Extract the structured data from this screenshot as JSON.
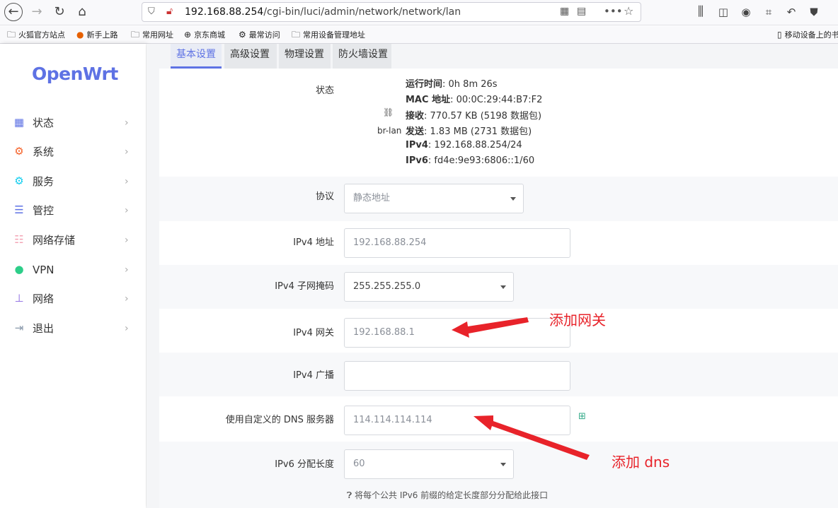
{
  "browser": {
    "url_host": "192.168.88.254",
    "url_path": "/cgi-bin/luci/admin/network/network/lan"
  },
  "bookmarks": [
    {
      "label": "火狐官方站点",
      "icon": "folder-icon"
    },
    {
      "label": "新手上路",
      "icon": "firefox-icon"
    },
    {
      "label": "常用网址",
      "icon": "folder-icon"
    },
    {
      "label": "京东商城",
      "icon": "globe-icon"
    },
    {
      "label": "最常访问",
      "icon": "gear-icon"
    },
    {
      "label": "常用设备管理地址",
      "icon": "folder-icon"
    }
  ],
  "mobile_bookmarks": "移动设备上的书",
  "logo": "OpenWrt",
  "nav": [
    {
      "label": "状态",
      "icon": "dashboard-icon",
      "color": "#5e72e4"
    },
    {
      "label": "系统",
      "icon": "gear-icon",
      "color": "#f5632a"
    },
    {
      "label": "服务",
      "icon": "cogs-icon",
      "color": "#11cdef"
    },
    {
      "label": "管控",
      "icon": "sliders-icon",
      "color": "#5e72e4"
    },
    {
      "label": "网络存储",
      "icon": "database-icon",
      "color": "#f3a4b5"
    },
    {
      "label": "VPN",
      "icon": "globe-icon",
      "color": "#2dce89"
    },
    {
      "label": "网络",
      "icon": "sitemap-icon",
      "color": "#8965e0"
    },
    {
      "label": "退出",
      "icon": "logout-icon",
      "color": "#8898aa"
    }
  ],
  "tabs": [
    "基本设置",
    "高级设置",
    "物理设置",
    "防火墙设置"
  ],
  "status": {
    "label": "状态",
    "iface": "br-lan",
    "uptime_key": "运行时间",
    "uptime_val": ": 0h 8m 26s",
    "mac_key": "MAC 地址",
    "mac_val": ": 00:0C:29:44:B7:F2",
    "rx_key": "接收",
    "rx_val": ": 770.57 KB (5198 数据包)",
    "tx_key": "发送",
    "tx_val": ": 1.83 MB (2731 数据包)",
    "ipv4_key": "IPv4",
    "ipv4_val": ": 192.168.88.254/24",
    "ipv6_key": "IPv6",
    "ipv6_val": ": fd4e:9e93:6806::1/60"
  },
  "fields": {
    "protocol_label": "协议",
    "protocol_value": "静态地址",
    "ipv4_addr_label": "IPv4 地址",
    "ipv4_addr_value": "192.168.88.254",
    "netmask_label": "IPv4 子网掩码",
    "netmask_value": "255.255.255.0",
    "gateway_label": "IPv4 网关",
    "gateway_value": "192.168.88.1",
    "broadcast_label": "IPv4 广播",
    "broadcast_value": "",
    "dns_label": "使用自定义的 DNS 服务器",
    "dns_value": "114.114.114.114",
    "ipv6_len_label": "IPv6 分配长度",
    "ipv6_len_value": "60",
    "ipv6_hint": "将每个公共 IPv6 前缀的给定长度部分分配给此接口"
  },
  "annotations": {
    "gateway": "添加网关",
    "dns": "添加 dns"
  }
}
